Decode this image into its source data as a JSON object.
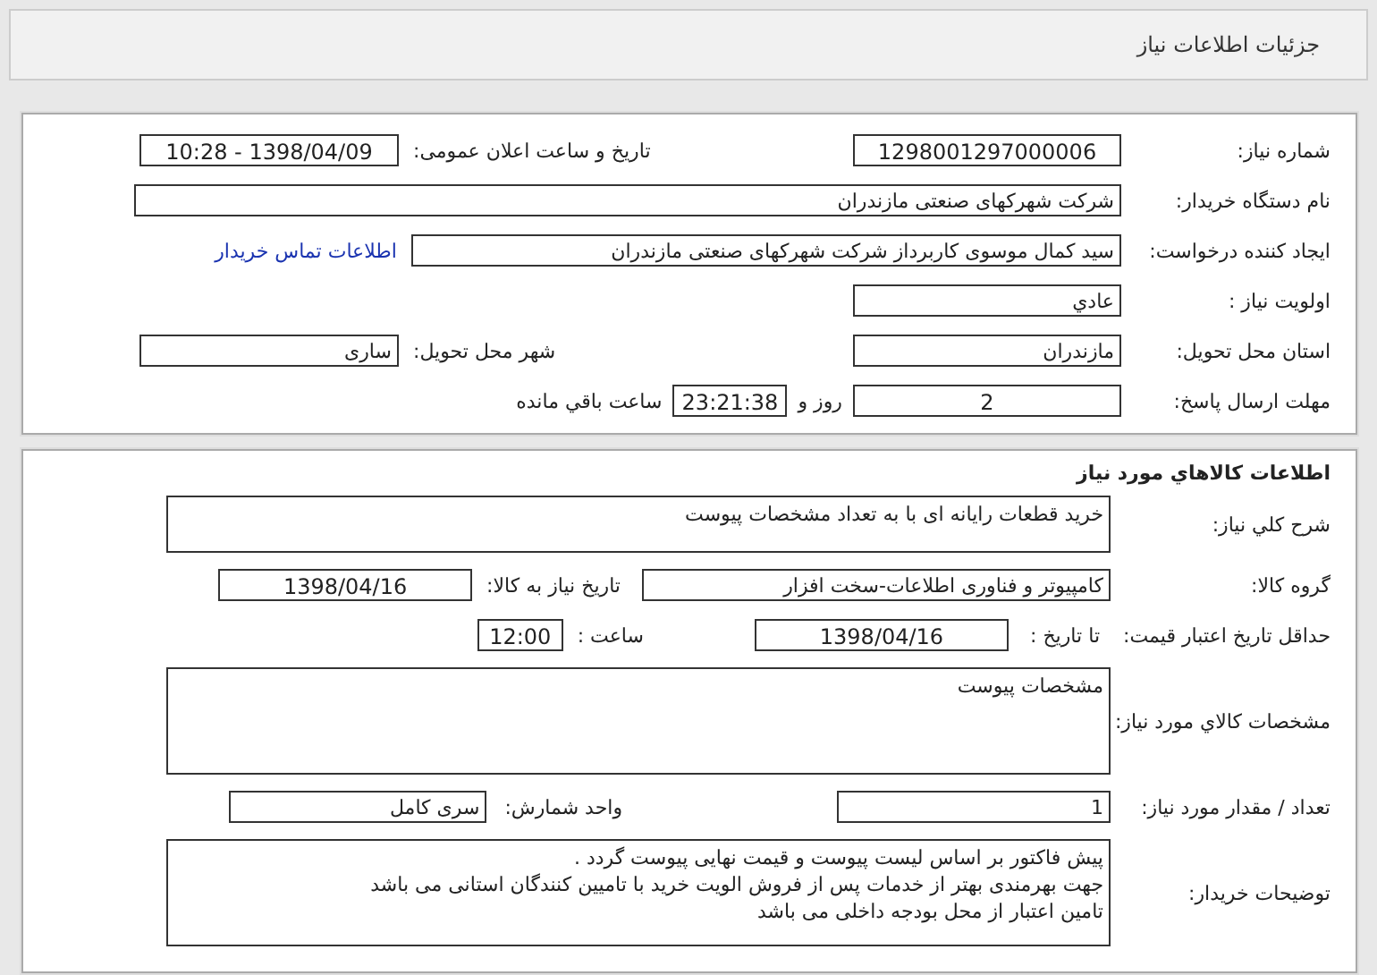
{
  "header": {
    "title": "جزئیات اطلاعات نیاز"
  },
  "need_info": {
    "need_number": {
      "label": "شماره نیاز:",
      "value": "1298001297000006"
    },
    "announce": {
      "label": "تاریخ و ساعت اعلان عمومی:",
      "value": "1398/04/09 - 10:28"
    },
    "buyer_org": {
      "label": "نام دستگاه خریدار:",
      "value": "شرکت شهرکهای صنعتی مازندران"
    },
    "requester": {
      "label": "ایجاد کننده درخواست:",
      "value": "سید کمال موسوی کاربرداز شرکت شهرکهای صنعتی مازندران",
      "link": "اطلاعات تماس خریدار"
    },
    "priority": {
      "label": "اولویت نیاز :",
      "value": "عادي"
    },
    "province": {
      "label": "استان محل تحویل:",
      "value": "مازندران"
    },
    "city": {
      "label": "شهر محل تحویل:",
      "value": "ساری"
    },
    "deadline": {
      "label": "مهلت ارسال پاسخ:",
      "days": "2",
      "days_label": "روز و",
      "time": "23:21:38",
      "remaining_label": "ساعت باقي مانده"
    }
  },
  "goods_info": {
    "title": "اطلاعات کالاهاي مورد نياز",
    "description": {
      "label": "شرح کلي نیاز:",
      "value": "خرید قطعات رایانه ای با به تعداد مشخصات پیوست"
    },
    "group": {
      "label": "گروه کالا:",
      "value": "کامپیوتر و فناوری اطلاعات-سخت افزار"
    },
    "need_date": {
      "label": "تاریخ نیاز به کالا:",
      "value": "1398/04/16"
    },
    "validity": {
      "label": "حداقل تاریخ اعتبار قیمت:",
      "to_label": "تا تاریخ :",
      "date": "1398/04/16",
      "time_label": "ساعت :",
      "time": "12:00"
    },
    "specs": {
      "label": "مشخصات کالاي مورد نياز:",
      "value": "مشخصات پیوست"
    },
    "quantity": {
      "label": "تعداد / مقدار مورد نیاز:",
      "value": "1"
    },
    "unit": {
      "label": "واحد شمارش:",
      "value": "سری کامل"
    },
    "notes": {
      "label": "توضیحات خریدار:",
      "lines": [
        "پیش فاکتور بر اساس لیست پیوست و قیمت نهایی پیوست گردد .",
        "جهت بهرمندی بهتر از خدمات پس از فروش الویت خرید با تامیین کنندگان استانی می باشد",
        "تامین اعتبار از محل بودجه داخلی می باشد"
      ]
    }
  }
}
